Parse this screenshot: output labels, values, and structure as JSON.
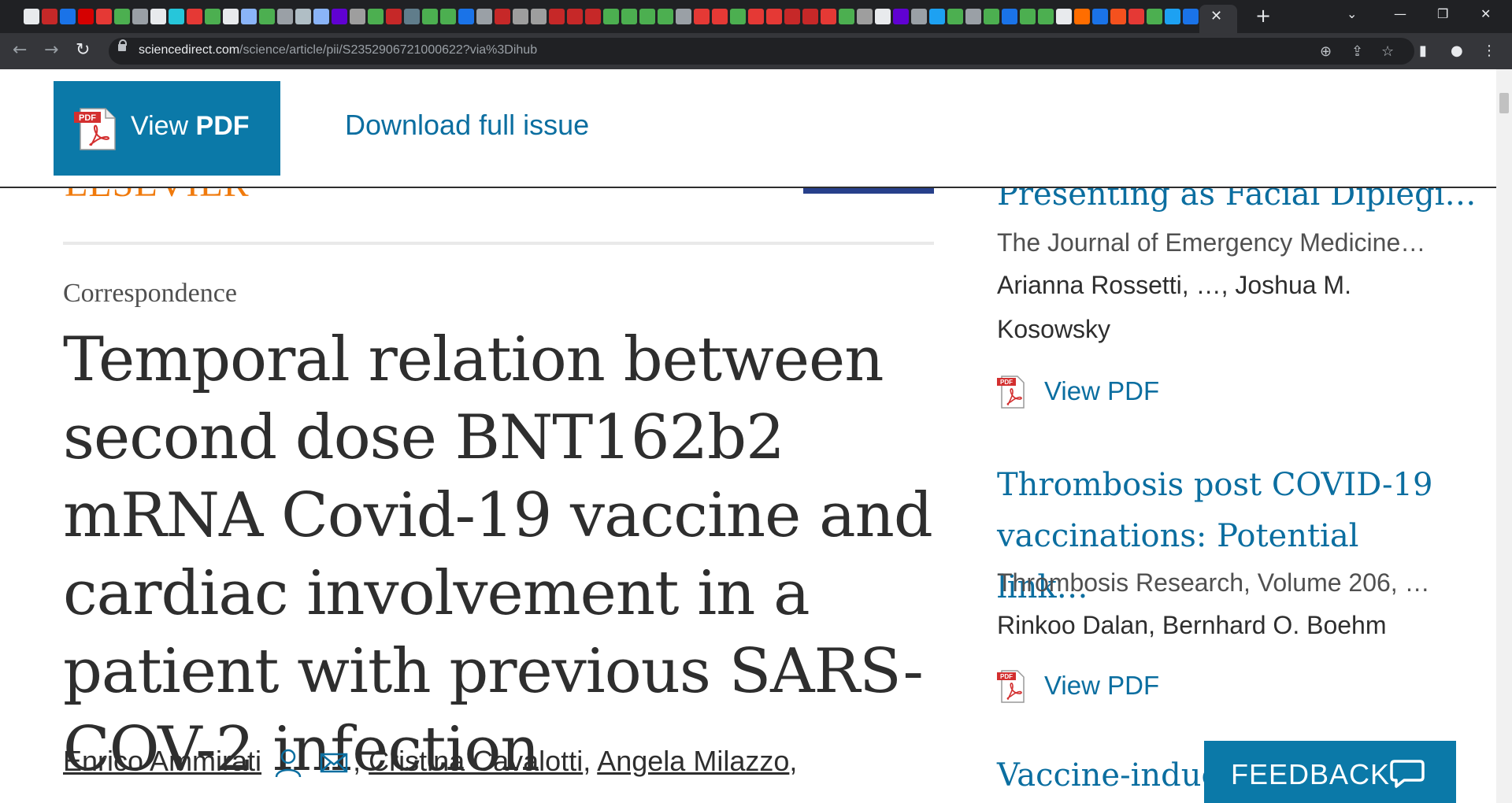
{
  "browser": {
    "url_host": "sciencedirect.com",
    "url_path": "/science/article/pii/S2352906721000622?via%3Dihub",
    "tab_icon_colors": [
      "#e8eaed",
      "#c62828",
      "#1a73e8",
      "#d50000",
      "#e53935",
      "#4caf50",
      "#9aa0a6",
      "#e8eaed",
      "#26c6da",
      "#e53935",
      "#4caf50",
      "#e8eaed",
      "#8ab4f8",
      "#4caf50",
      "#9aa0a6",
      "#b0bec5",
      "#8ab4f8",
      "#6001d2",
      "#9e9e9e",
      "#4caf50",
      "#c62828",
      "#607d8b",
      "#4caf50",
      "#4caf50",
      "#1a73e8",
      "#9aa0a6",
      "#c62828",
      "#9e9e9e",
      "#9e9e9e",
      "#c62828",
      "#c62828",
      "#c62828",
      "#4caf50",
      "#4caf50",
      "#4caf50",
      "#4caf50",
      "#9aa0a6",
      "#e53935",
      "#e53935",
      "#4caf50",
      "#e53935",
      "#e53935",
      "#c62828",
      "#c62828",
      "#e53935",
      "#4caf50",
      "#9e9e9e",
      "#e8eaed",
      "#6001d2",
      "#9aa0a6",
      "#1da1f2",
      "#4caf50",
      "#9aa0a6",
      "#4caf50",
      "#1a73e8",
      "#4caf50",
      "#4caf50",
      "#e8eaed",
      "#ff6d00",
      "#1a73e8",
      "#f4511e",
      "#e53935",
      "#4caf50",
      "#1da1f2",
      "#1a73e8",
      "#1a73e8",
      "#c62828",
      "#1a73e8",
      "#e53935",
      "#1a73e8",
      "#e53935",
      "#f4511e",
      "#c62828",
      "#6001d2",
      "#ff7043"
    ],
    "active_tab_close": "✕",
    "new_tab": "+"
  },
  "header": {
    "view_pdf_label_light": "View",
    "view_pdf_label_bold": "PDF",
    "pdf_badge": "PDF",
    "download_full_issue": "Download full issue"
  },
  "article": {
    "publisher_logo_text": "ELSEVIER",
    "section": "Correspondence",
    "title": "Temporal relation between second dose BNT162b2 mRNA Covid-19 vaccine and cardiac involvement in a patient with previous SARS-COV-2 infection",
    "authors": [
      {
        "name": "Enrico Ammirati",
        "sep": ""
      },
      {
        "name": "Cristina Cavalotti",
        "sep": ", "
      },
      {
        "name": "Angela Milazzo",
        "sep": ", "
      }
    ],
    "authors_trailing": ","
  },
  "sidebar": {
    "items": [
      {
        "title": "Presenting as Facial Diplegi…",
        "journal": "The Journal of Emergency Medicine…",
        "authors_line1": "Arianna Rossetti, …, Joshua M.",
        "authors_line2": "Kosowsky",
        "view_pdf": "View PDF"
      },
      {
        "title": "Thrombosis post COVID-19 vaccinations: Potential link…",
        "journal": "Thrombosis Research, Volume 206, …",
        "authors_line1": "Rinkoo Dalan, Bernhard O. Boehm",
        "view_pdf": "View PDF"
      },
      {
        "title": "Vaccine-induc"
      }
    ]
  },
  "feedback": {
    "label": "FEEDBACK"
  }
}
